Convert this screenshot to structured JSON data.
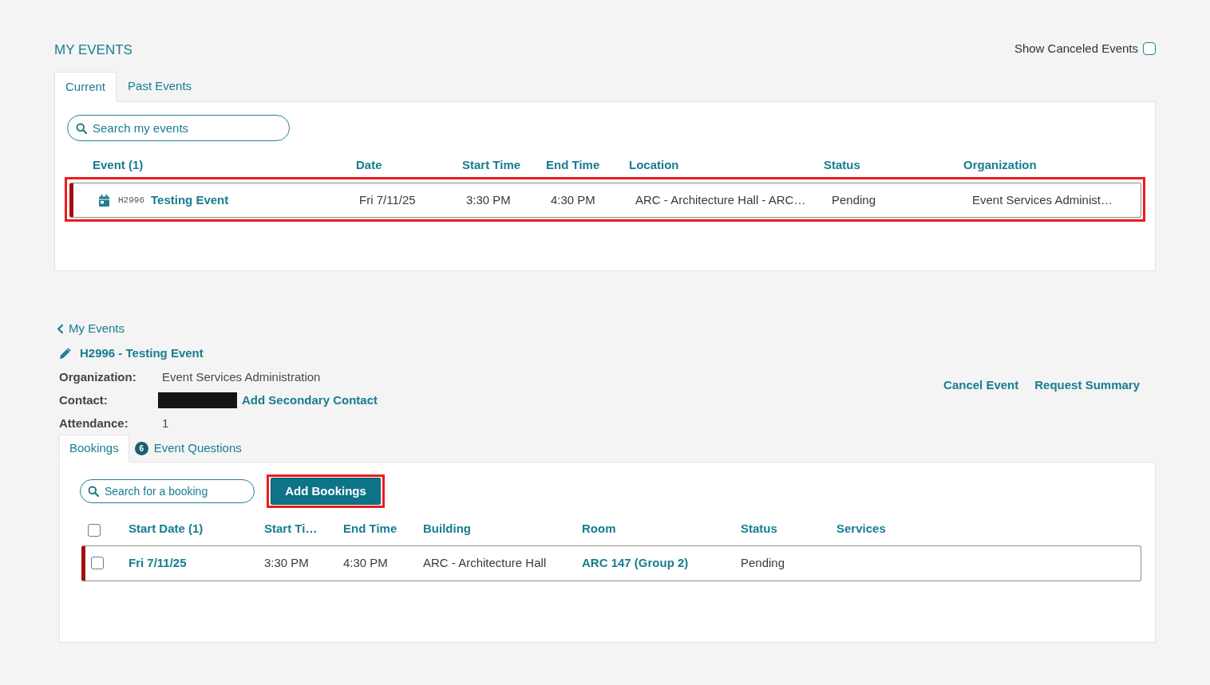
{
  "page_title": "MY EVENTS",
  "show_canceled": {
    "label": "Show Canceled Events",
    "checked": false
  },
  "event_tabs": [
    {
      "label": "Current",
      "selected": true
    },
    {
      "label": "Past Events",
      "selected": false
    }
  ],
  "event_search": {
    "placeholder": "Search my events"
  },
  "events_table": {
    "columns": [
      "Event (1)",
      "Date",
      "Start Time",
      "End Time",
      "Location",
      "Status",
      "Organization"
    ],
    "rows": [
      {
        "code": "H2996",
        "name": "Testing Event",
        "date": "Fri 7/11/25",
        "start_time": "3:30 PM",
        "end_time": "4:30 PM",
        "location": "ARC - Architecture Hall - ARC…",
        "status": "Pending",
        "organization": "Event Services Administ…",
        "highlighted": true
      }
    ]
  },
  "detail": {
    "back_link": "My Events",
    "title": "H2996 - Testing Event",
    "fields": [
      {
        "kind": "text",
        "label": "Organization:",
        "value": "Event Services Administration"
      },
      {
        "kind": "contact",
        "label": "Contact:",
        "redacted": true,
        "link": "Add Secondary Contact"
      },
      {
        "kind": "text",
        "label": "Attendance:",
        "value": "1"
      }
    ],
    "actions": [
      "Cancel Event",
      "Request Summary"
    ],
    "tabs": [
      {
        "label": "Bookings",
        "selected": true
      },
      {
        "label": "Event Questions",
        "badge": "6",
        "selected": false
      }
    ],
    "booking_search": {
      "placeholder": "Search for a booking"
    },
    "add_button": {
      "label": "Add Bookings",
      "highlighted": true
    },
    "bookings_table": {
      "select_all_checked": false,
      "columns": [
        "Start Date (1)",
        "Start Ti…",
        "End Time",
        "Building",
        "Room",
        "Status",
        "Services"
      ],
      "rows": [
        {
          "checked": false,
          "start_date": "Fri 7/11/25",
          "start_time": "3:30 PM",
          "end_time": "4:30 PM",
          "building": "ARC - Architecture Hall",
          "room": "ARC 147 (Group 2)",
          "status": "Pending"
        }
      ]
    }
  }
}
